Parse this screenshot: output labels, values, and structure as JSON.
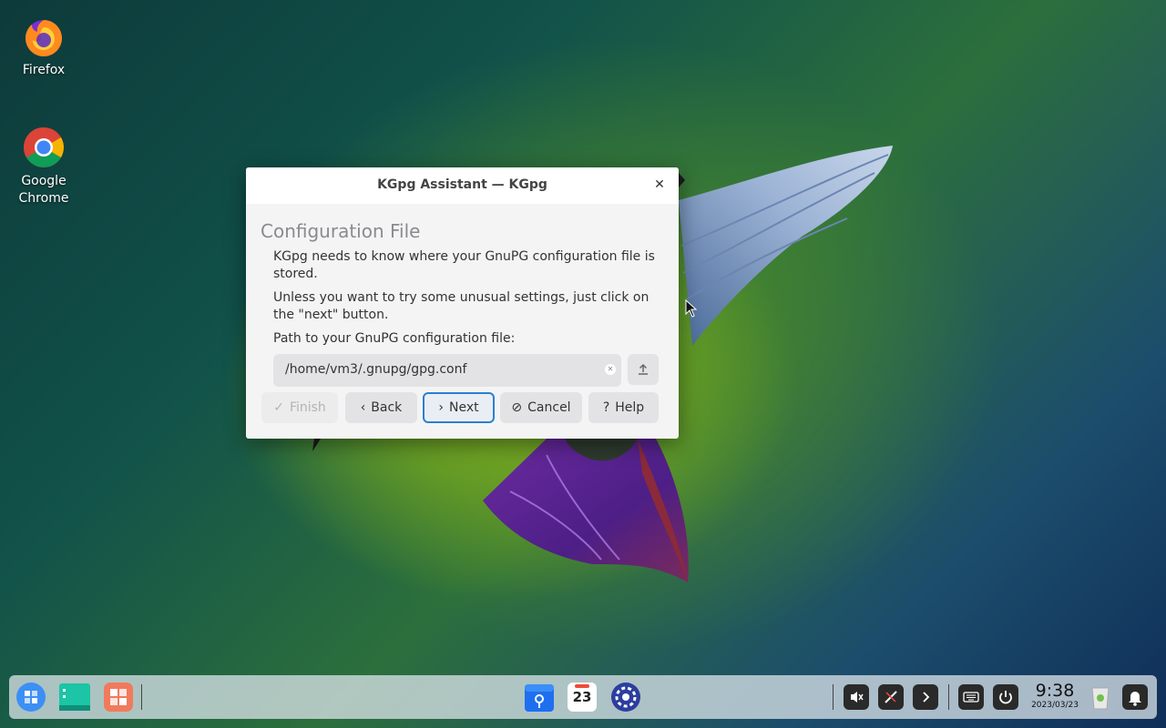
{
  "desktop": {
    "icons": [
      {
        "label": "Firefox",
        "icon": "firefox-icon"
      },
      {
        "label": "Google Chrome",
        "icon": "chrome-icon"
      }
    ]
  },
  "dialog": {
    "title": "KGpg Assistant — KGpg",
    "close": "✕",
    "heading": "Configuration File",
    "para1": "KGpg needs to know where your GnuPG configuration file is stored.",
    "para2": "Unless you want to try some unusual settings, just click on the \"next\" button.",
    "path_label": "Path to your GnuPG configuration file:",
    "path_value": "/home/vm3/.gnupg/gpg.conf",
    "buttons": {
      "finish": "Finish",
      "back": "Back",
      "next": "Next",
      "cancel": "Cancel",
      "help": "Help"
    }
  },
  "taskbar": {
    "time": "9:38",
    "date": "2023/03/23",
    "calendar_day": "23"
  },
  "colors": {
    "accent": "#2a7fd4",
    "launcher": "#3d8ff5",
    "file_manager": "#1bc5a5",
    "app_store": "#f07b5c"
  }
}
